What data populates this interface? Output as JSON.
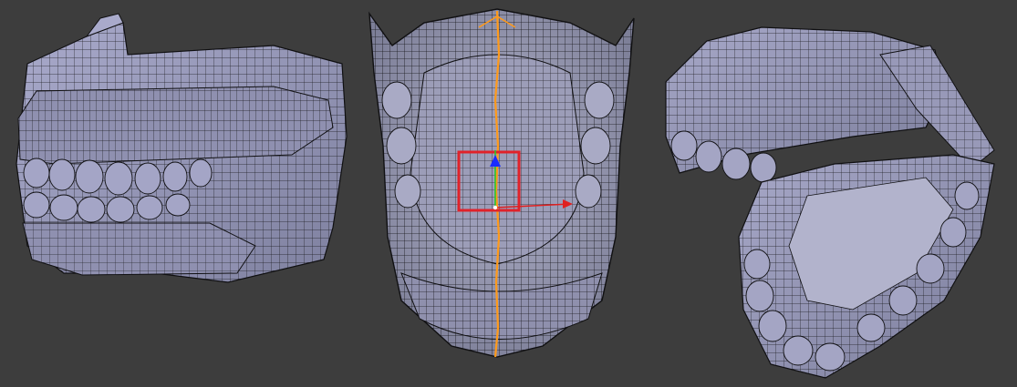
{
  "viewport": {
    "background": "#3d3d3d"
  },
  "panels": [
    {
      "id": "left",
      "content": "teeth-mesh-angled-view"
    },
    {
      "id": "middle",
      "content": "teeth-mesh-bottom-view-selected-seam"
    },
    {
      "id": "right",
      "content": "teeth-mesh-open-jaw-view"
    }
  ],
  "colors": {
    "mesh_fill": "#9b9cbc",
    "mesh_fill_dark": "#6f7090",
    "mesh_edge": "#101012",
    "selected_edge": "#ff9a1a",
    "selection_box": "#e0222a",
    "gizmo_x": "#e02020",
    "gizmo_y": "#22cc22",
    "gizmo_z": "#1a2cff"
  },
  "icons": {
    "transform_gizmo": "transform-gizmo-icon",
    "selection_box": "selection-box-icon"
  }
}
